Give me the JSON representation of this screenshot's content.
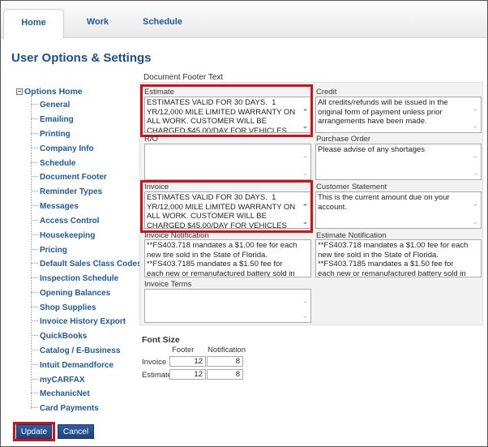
{
  "tabs": [
    {
      "label": "Home"
    },
    {
      "label": "Work"
    },
    {
      "label": "Schedule"
    }
  ],
  "page_title": "User Options & Settings",
  "tree": {
    "root_label": "Options Home",
    "items": [
      {
        "label": "General"
      },
      {
        "label": "Emailing"
      },
      {
        "label": "Printing"
      },
      {
        "label": "Company Info"
      },
      {
        "label": "Schedule"
      },
      {
        "label": "Document Footer"
      },
      {
        "label": "Reminder Types"
      },
      {
        "label": "Messages"
      },
      {
        "label": "Access Control"
      },
      {
        "label": "Housekeeping"
      },
      {
        "label": "Pricing"
      },
      {
        "label": "Default Sales Class Codes"
      },
      {
        "label": "Inspection Schedule"
      },
      {
        "label": "Opening Balances"
      },
      {
        "label": "Shop Supplies"
      },
      {
        "label": "Invoice History Export"
      },
      {
        "label": "QuickBooks"
      },
      {
        "label": "Catalog / E-Business"
      },
      {
        "label": "Intuit Demandforce"
      },
      {
        "label": "myCARFAX"
      },
      {
        "label": "MechanicNet"
      },
      {
        "label": "Card Payments"
      }
    ]
  },
  "footer_section": {
    "label": "Document Footer Text",
    "estimate": {
      "label": "Estimate",
      "value": "ESTIMATES VALID FOR 30 DAYS.  1 YR/12,000 MILE LIMITED WARRANTY ON ALL WORK. CUSTOMER WILL BE CHARGED $45.00/DAY FOR VEHICLES NOT PICKED UP"
    },
    "credit": {
      "label": "Credit",
      "value": "All credits/refunds will be issued in the original form of payment unless prior arrangements have been made."
    },
    "ro": {
      "label": "R/O",
      "value": ""
    },
    "purchase_order": {
      "label": "Purchase Order",
      "value": "Please advise of any shortages"
    },
    "invoice": {
      "label": "Invoice",
      "value": "ESTIMATES VALID FOR 30 DAYS.  1 YR/12,000 MILE LIMITED WARRANTY ON ALL WORK. CUSTOMER WILL BE CHARGED $45.00/DAY FOR VEHICLES NOT PICKED UP"
    },
    "customer_statement": {
      "label": "Customer Statement",
      "value": "This is the current amount due on your account."
    },
    "invoice_notification": {
      "label": "Invoice Notification",
      "value": "**FS403.718 mandates a $1.00 fee for each new tire sold in the State of Florida.\n**FS403.7185 mandates a $1.50 fee for each new or remanufactured battery sold in"
    },
    "estimate_notification": {
      "label": "Estimate Notification",
      "value": "**FS403.718 mandates a $1.00 fee for each new tire sold in the State of Florida.\n**FS403.7185 mandates a $1.50 fee for each new or remanufactured battery sold in"
    },
    "invoice_terms": {
      "label": "Invoice Terms",
      "value": ""
    }
  },
  "font_size": {
    "title": "Font Size",
    "col_footer": "Footer",
    "col_notification": "Notification",
    "rows": [
      {
        "label": "Invoice",
        "footer": "12",
        "notification": "8"
      },
      {
        "label": "Estimate",
        "footer": "12",
        "notification": "8"
      }
    ]
  },
  "buttons": {
    "update": "Update",
    "cancel": "Cancel"
  },
  "colors": {
    "accent": "#1e5a9a",
    "title": "#1b4f86",
    "highlight": "#d0121b",
    "button": "#1d457e"
  }
}
